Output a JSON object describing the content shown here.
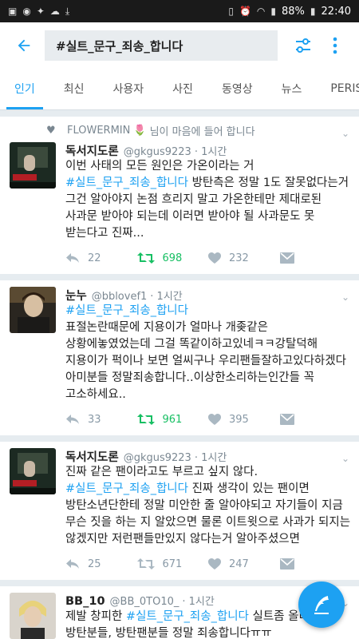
{
  "status_bar": {
    "battery": "88%",
    "time": "22:40"
  },
  "search": {
    "query": "#실트_문구_죄송_합니다"
  },
  "tabs": [
    {
      "label": "인기",
      "active": true
    },
    {
      "label": "최신"
    },
    {
      "label": "사용자"
    },
    {
      "label": "사진"
    },
    {
      "label": "동영상"
    },
    {
      "label": "뉴스"
    },
    {
      "label": "PERISC"
    }
  ],
  "tweets": [
    {
      "social_context_name": "FLOWERMIN",
      "social_context_emoji": "🌷",
      "social_context_text": "님이 마음에 들어 합니다",
      "name": "독서지도론",
      "handle": "@gkgus9223",
      "time": "· 1시간",
      "text_pre": "이번 사태의 모든 원인은 가온이라는 거\n",
      "hashtag": "#실트_문구_죄송_합니다",
      "text_post": " 방탄측은 정말 1도 잘못없다는거 그건 알아야지 논점 흐리지 말고 가온한테만 제대로된 사과문 받아야 되는데 이러면 받아야 될 사과문도 못 받는다고 진짜...",
      "replies": "22",
      "retweets": "698",
      "likes": "232",
      "retweeted": true
    },
    {
      "name": "눈누",
      "handle": "@bblovef1",
      "time": "· 1시간",
      "text_pre": "",
      "hashtag": "#실트_문구_죄송_합니다",
      "text_post": "\n표절논란때문에 지용이가 얼마나 개좆같은 상황에놓였었는데 그걸 똑같이하고있네ㅋㅋ강탈덕해 지용이가 퍽이나 보면 얼씨구나 우리팬들잘하고있다하겠다\n아미분들 정말죄송합니다..이상한소리하는인간들 꼭 고소하세요..",
      "replies": "33",
      "retweets": "961",
      "likes": "395",
      "retweeted": true
    },
    {
      "name": "독서지도론",
      "handle": "@gkgus9223",
      "time": "· 1시간",
      "text_pre": "진짜 같은 팬이라고도 부르고 싶지 않다.\n",
      "hashtag": "#실트_문구_죄송_합니다",
      "text_post": " 진짜 생각이 있는 팬이면 방탄소년단한테 정말 미안한 줄 알아야되고 자기들이 지금 무슨 짓을 하는 지 알았으면 물론 이트윗으로 사과가 되지는 않겠지만 저런팬들만있지 않다는거 알아주셨으면",
      "replies": "25",
      "retweets": "671",
      "likes": "247",
      "retweeted": false
    },
    {
      "name": "BB_10",
      "handle": "@BB_0TO10_",
      "time": "· 1시간",
      "text_pre": "제발 창피한 ",
      "hashtag": "#실트_문구_죄송_합니다",
      "text_post": " 실트좀 올리지마.방탄분들, 방탄팬분들 정말 죄송합니다ㅠㅠ",
      "replies": "",
      "retweets": "",
      "likes": "",
      "retweeted": false
    }
  ],
  "colors": {
    "accent": "#1da1f2",
    "retweet": "#17bf63"
  }
}
